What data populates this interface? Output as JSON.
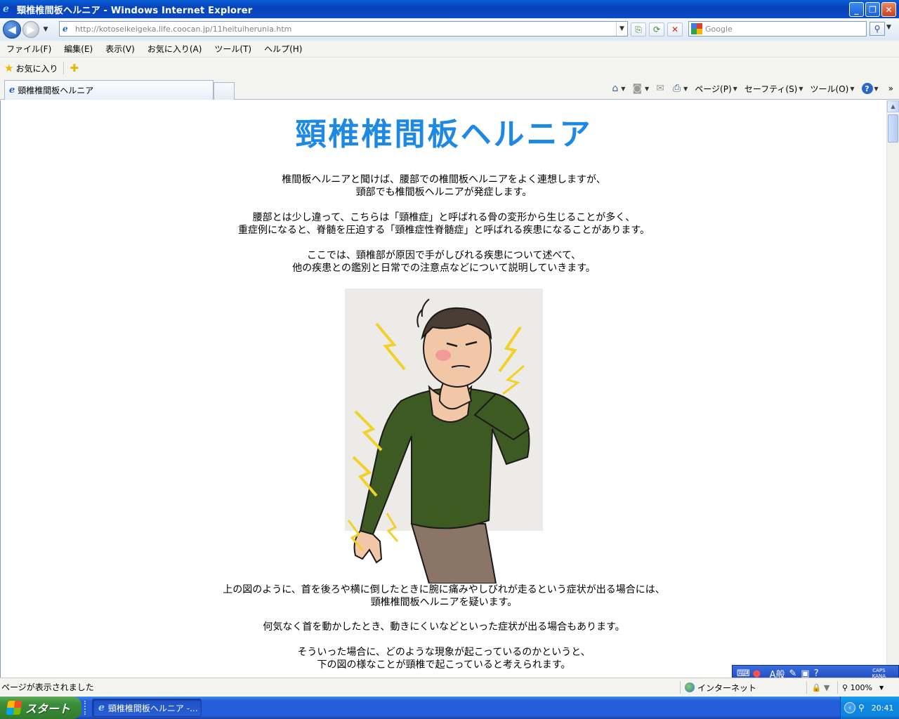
{
  "window": {
    "title": "頸椎椎間板ヘルニア - Windows Internet Explorer"
  },
  "address": {
    "url": "http://kotoseikeigeka.life.coocan.jp/11heituiherunia.htm"
  },
  "search": {
    "placeholder": "Google"
  },
  "menu": {
    "items": [
      "ファイル(F)",
      "編集(E)",
      "表示(V)",
      "お気に入り(A)",
      "ツール(T)",
      "ヘルプ(H)"
    ]
  },
  "favorites": {
    "label": "お気に入り"
  },
  "tab": {
    "title": "頸椎椎間板ヘルニア"
  },
  "commandbar": {
    "page": "ページ(P)",
    "safety": "セーフティ(S)",
    "tools": "ツール(O)"
  },
  "page": {
    "heading": "頸椎椎間板ヘルニア",
    "paragraphs": [
      [
        "椎間板ヘルニアと聞けば、腰部での椎間板ヘルニアをよく連想しますが、",
        "頸部でも椎間板ヘルニアが発症します。"
      ],
      [
        "腰部とは少し違って、こちらは「頸椎症」と呼ばれる骨の変形から生じることが多く、",
        "重症例になると、脊髄を圧迫する「頸椎症性脊髄症」と呼ばれる疾患になることがあります。"
      ],
      [
        "ここでは、頸椎部が原因で手がしびれる疾患について述べて、",
        "他の疾患との鑑別と日常での注意点などについて説明していきます。"
      ],
      [
        "上の図のように、首を後ろや横に倒したときに腕に痛みやしびれが走るという症状が出る場合には、",
        "頸椎椎間板ヘルニアを疑います。"
      ],
      [
        "何気なく首を動かしたとき、動きにくいなどといった症状が出る場合もあります。"
      ],
      [
        "そういった場合に、どのような現象が起こっているのかというと、",
        "下の図の様なことが頸椎で起こっていると考えられます。"
      ]
    ]
  },
  "ime": {
    "mode": "_A般",
    "caps": "CAPS",
    "kana": "KANA"
  },
  "status": {
    "text": "ページが表示されました",
    "zone": "インターネット",
    "zoom": "100%"
  },
  "taskbar": {
    "start": "スタート",
    "task": "頸椎椎間板ヘルニア -...",
    "clock": "20:41"
  }
}
